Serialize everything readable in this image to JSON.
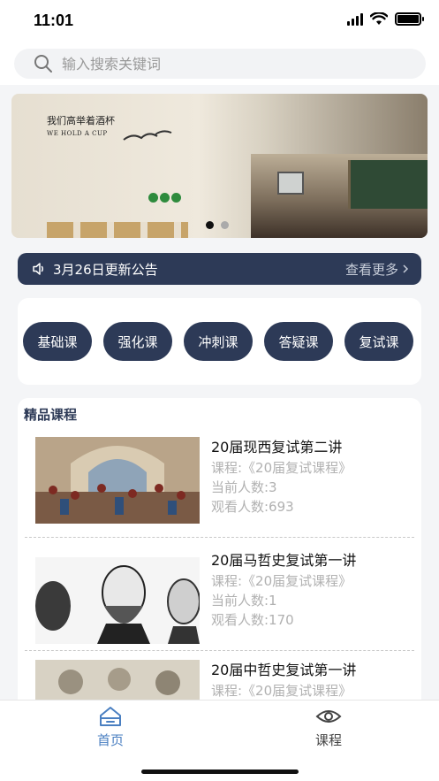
{
  "status_bar": {
    "time": "11:01"
  },
  "search": {
    "placeholder": "输入搜索关键词"
  },
  "banner": {
    "calligraphy_title": "我们高举着酒杯",
    "calligraphy_subtitle": "WE HOLD A CUP",
    "dots_total": 2,
    "active_dot": 1
  },
  "notice": {
    "text": "3月26日更新公告",
    "more": "查看更多",
    "icon": "speaker-icon"
  },
  "categories": [
    "基础课",
    "强化课",
    "冲刺课",
    "答疑课",
    "复试课"
  ],
  "courses": {
    "heading": "精品课程",
    "items": [
      {
        "title": "20届现西复试第二讲",
        "course": "课程:《20届复试课程》",
        "current": "当前人数:3",
        "views": "观看人数:693"
      },
      {
        "title": "20届马哲史复试第一讲",
        "course": "课程:《20届复试课程》",
        "current": "当前人数:1",
        "views": "观看人数:170"
      },
      {
        "title": "20届中哲史复试第一讲",
        "course": "课程:《20届复试课程》",
        "current": "",
        "views": ""
      }
    ]
  },
  "tabbar": {
    "home": {
      "label": "首页",
      "icon": "home-icon",
      "active": true
    },
    "courses": {
      "label": "课程",
      "icon": "eye-icon",
      "active": false
    }
  },
  "colors": {
    "primary": "#2d3a57",
    "tab_active": "#4a7fc1",
    "muted": "#b1b1b1"
  }
}
